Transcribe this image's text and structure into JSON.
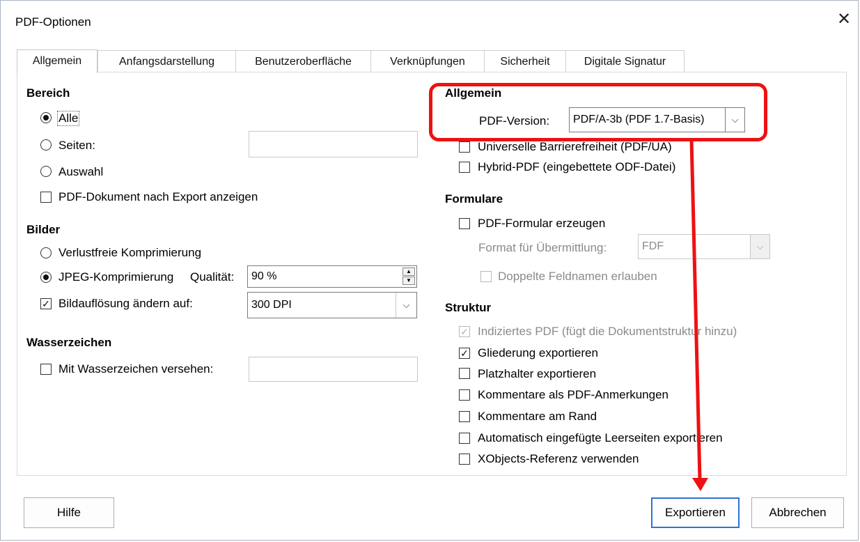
{
  "window": {
    "title": "PDF-Optionen",
    "close": "✕"
  },
  "tabs": [
    "Allgemein",
    "Anfangsdarstellung",
    "Benutzeroberfläche",
    "Verknüpfungen",
    "Sicherheit",
    "Digitale Signatur"
  ],
  "bereich": {
    "heading": "Bereich",
    "alle": "Alle",
    "seiten": "Seiten:",
    "seiten_value": "",
    "auswahl": "Auswahl",
    "show_after_export": "PDF-Dokument nach Export anzeigen"
  },
  "bilder": {
    "heading": "Bilder",
    "lossless": "Verlustfreie Komprimierung",
    "jpeg": "JPEG-Komprimierung",
    "quality_label": "Qualität:",
    "quality_value": "90 %",
    "resolution_label": "Bildauflösung ändern auf:",
    "resolution_value": "300 DPI"
  },
  "wasserzeichen": {
    "heading": "Wasserzeichen",
    "label": "Mit Wasserzeichen versehen:",
    "value": ""
  },
  "allgemein": {
    "heading": "Allgemein",
    "pdf_version_label": "PDF-Version:",
    "pdf_version_value": "PDF/A-3b (PDF 1.7-Basis)",
    "universal": "Universelle Barrierefreiheit (PDF/UA)",
    "hybrid": "Hybrid-PDF (eingebettete ODF-Datei)"
  },
  "formulare": {
    "heading": "Formulare",
    "create": "PDF-Formular erzeugen",
    "format_label": "Format für Übermittlung:",
    "format_value": "FDF",
    "duplicate": "Doppelte Feldnamen erlauben"
  },
  "struktur": {
    "heading": "Struktur",
    "tagged": "Indiziertes PDF (fügt die Dokumentstruktur hinzu)",
    "outline": "Gliederung exportieren",
    "placeholders": "Platzhalter exportieren",
    "comments_annotations": "Kommentare als PDF-Anmerkungen",
    "comments_margin": "Kommentare am Rand",
    "blank_pages": "Automatisch eingefügte Leerseiten exportieren",
    "xobjects": "XObjects-Referenz verwenden"
  },
  "buttons": {
    "help": "Hilfe",
    "export": "Exportieren",
    "cancel": "Abbrechen"
  },
  "annotation": {
    "color": "#ee1111"
  }
}
